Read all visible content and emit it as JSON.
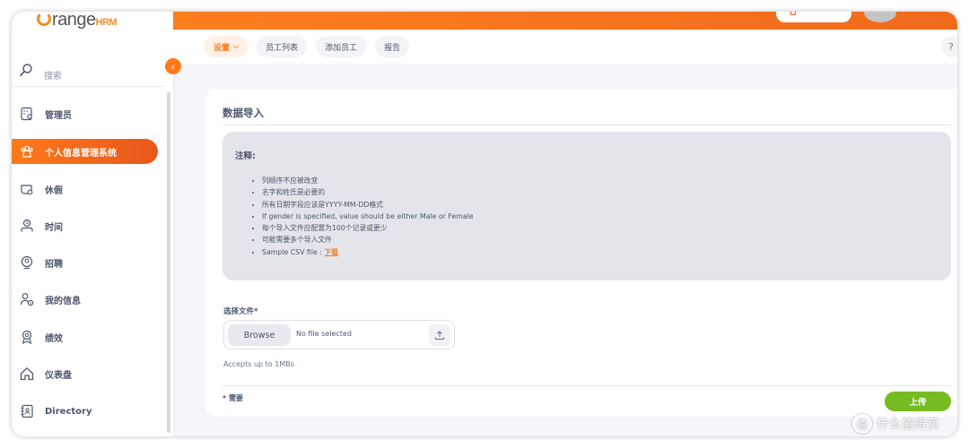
{
  "brand": {
    "name_prefix": "range",
    "name_suffix": "HRM"
  },
  "sidebar": {
    "search_label": "搜索",
    "items": [
      {
        "label": "管理员",
        "icon": "admin-icon"
      },
      {
        "label": "个人信息管理系统",
        "icon": "pim-icon",
        "active": true
      },
      {
        "label": "休假",
        "icon": "leave-icon"
      },
      {
        "label": "时间",
        "icon": "time-icon"
      },
      {
        "label": "招聘",
        "icon": "recruitment-icon"
      },
      {
        "label": "我的信息",
        "icon": "my-info-icon"
      },
      {
        "label": "绩效",
        "icon": "performance-icon"
      },
      {
        "label": "仪表盘",
        "icon": "dashboard-icon"
      },
      {
        "label": "Directory",
        "icon": "directory-icon"
      }
    ]
  },
  "subnav": {
    "tabs": [
      {
        "label": "设置",
        "active": true
      },
      {
        "label": "员工列表"
      },
      {
        "label": "添加员工"
      },
      {
        "label": "报告"
      }
    ],
    "help": "?"
  },
  "card": {
    "title": "数据导入",
    "note": {
      "title": "注释:",
      "items": [
        "列顺序不应被改变",
        "名字和姓氏是必要的",
        "所有日期字段应该是YYYY-MM-DD格式",
        "If gender is specified, value should be either Male or Female",
        "每个导入文件应配置为100个记录或更少",
        "可能需要多个导入文件"
      ],
      "sample_prefix": "Sample CSV file : ",
      "sample_link": "下载"
    },
    "file_label": "选择文件*",
    "browse": "Browse",
    "no_file": "No file selected",
    "accepts": "Accepts up to 1MBs",
    "required": "* 需要",
    "submit": "上传"
  },
  "watermark": {
    "text": "什么值得买",
    "icon_char": "值"
  },
  "colors": {
    "accent": "#ff7a1a",
    "success": "#76bc21",
    "note_bg": "#e4e5ea"
  }
}
